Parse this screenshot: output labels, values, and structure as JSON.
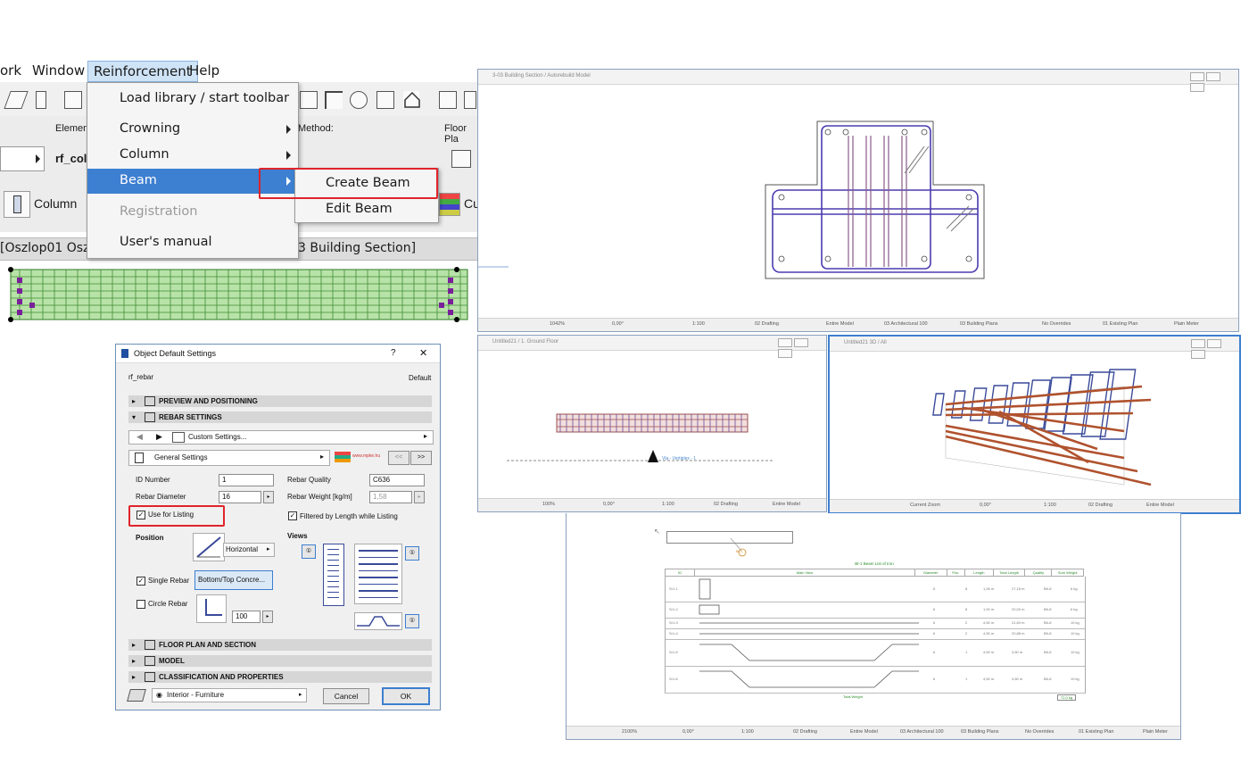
{
  "menubar": {
    "items": [
      "ork",
      "Window",
      "Reinforcement",
      "Help"
    ]
  },
  "reinforcement_menu": {
    "items": [
      {
        "label": "Load library / start toolbar"
      },
      {
        "label": "Crowning"
      },
      {
        "label": "Column"
      },
      {
        "label": "Beam"
      },
      {
        "label": "Registration"
      },
      {
        "label": "User's manual"
      }
    ],
    "submenu": [
      "Create Beam",
      "Edit Beam"
    ]
  },
  "infobox": {
    "element_label": "Elemen",
    "element_value": "rf_col",
    "method_label": "Method:",
    "floor_plan_label": "Floor Pla",
    "column_label": "Column",
    "cu_label": "Cu"
  },
  "tabs": {
    "left": "[Oszlop01 Oszl",
    "right": "3 Building Section]"
  },
  "section_window": {
    "title": "3-03 Building Section / Autorebuild Model",
    "status": [
      "1042%",
      "0,00°",
      "1:100",
      "02 Drafting",
      "Entire Model",
      "03 Architectural 100",
      "03 Building Plans",
      "No Overrides",
      "01 Existing Plan",
      "Plain Meter"
    ]
  },
  "plan_window": {
    "title": "Untitled21 / 1. Ground Floor",
    "marker_label": "Vla - Vertiplex - 1",
    "status": [
      "100%",
      "0,00°",
      "1:100",
      "02 Drafting",
      "Entire Model"
    ]
  },
  "view3d_window": {
    "title": "Untitled21 3D / All",
    "status": [
      "Current Zoom",
      "0,00°",
      "1:100",
      "02 Drafting",
      "Entire Model"
    ]
  },
  "schedule_window": {
    "table_title": "Bt-1 Beam List of Iron",
    "headers": [
      "ID",
      "Main View",
      "Diameter",
      "Pcs.",
      "Length",
      "Total Length",
      "Quality",
      "Sum Weight"
    ],
    "rows": [
      [
        "Sr1-1",
        "6",
        "8",
        "1,06 m",
        "27,18 m",
        "B6-8",
        "6 kg"
      ],
      [
        "Sr1-2",
        "6",
        "8",
        "1,00 m",
        "20,00 m",
        "B6-8",
        "6 kg"
      ],
      [
        "Sr1-3",
        "6",
        "2",
        "4,50 m",
        "21,60 m",
        "B6-8",
        "10 kg"
      ],
      [
        "Sr1-4",
        "6",
        "2",
        "4,50 m",
        "20,88 m",
        "B6-8",
        "10 kg"
      ],
      [
        "Sr1-5",
        "6",
        "1",
        "4,50 m",
        "3,80 m",
        "B6-8",
        "10 kg"
      ],
      [
        "Sr1-6",
        "6",
        "1",
        "4,50 m",
        "3,80 m",
        "B6-8",
        "10 kg"
      ]
    ],
    "total_label": "Total Weight",
    "total_value": "72,0 kg",
    "callout": "Bt-1",
    "status": [
      "2100%",
      "0,00°",
      "1:100",
      "02 Drafting",
      "Entire Model",
      "03 Architectural 100",
      "03 Building Plans",
      "No Overrides",
      "01 Existing Plan",
      "Plain Meter"
    ]
  },
  "dialog": {
    "title": "Object Default Settings",
    "help": "?",
    "close": "✕",
    "object_name": "rf_rebar",
    "default_label": "Default",
    "sections": {
      "preview": "PREVIEW AND POSITIONING",
      "rebar": "REBAR SETTINGS",
      "floorplan": "FLOOR PLAN AND SECTION",
      "model": "MODEL",
      "classification": "CLASSIFICATION AND PROPERTIES"
    },
    "custom_settings": "Custom Settings...",
    "general_settings": "General Settings",
    "logo_text": "www.mpke.hu",
    "nav_prev": "<<",
    "nav_next": ">>",
    "id_number_label": "ID Number",
    "id_number_value": "1",
    "rebar_quality_label": "Rebar Quality",
    "rebar_quality_value": "C636",
    "rebar_diameter_label": "Rebar Diameter",
    "rebar_diameter_value": "16",
    "rebar_weight_label": "Rebar Weight [kg/m]",
    "rebar_weight_value": "1,58",
    "use_for_listing": "Use for Listing",
    "filtered_by_length": "Filtered by Length while Listing",
    "position_label": "Position",
    "horizontal_label": "Horizontal",
    "views_label": "Views",
    "single_rebar": "Single Rebar",
    "bottom_top": "Bottom/Top Concre...",
    "circle_rebar": "Circle Rebar",
    "circle_value": "100",
    "layer": "Interior - Furniture",
    "cancel": "Cancel",
    "ok": "OK"
  }
}
